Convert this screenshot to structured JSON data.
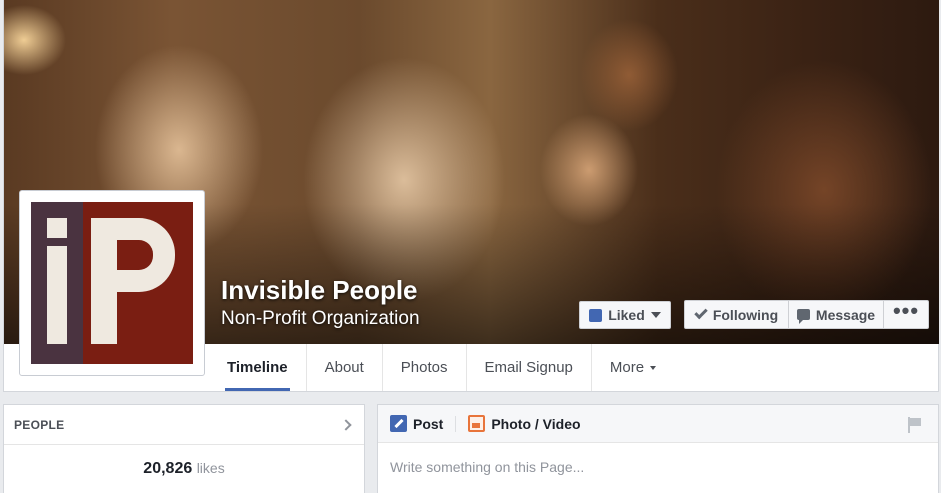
{
  "page": {
    "name": "Invisible People",
    "category": "Non-Profit Organization"
  },
  "actions": {
    "liked_label": "Liked",
    "following_label": "Following",
    "message_label": "Message",
    "more_label": "•••"
  },
  "tabs": [
    {
      "label": "Timeline",
      "active": true
    },
    {
      "label": "About"
    },
    {
      "label": "Photos"
    },
    {
      "label": "Email Signup"
    },
    {
      "label": "More"
    }
  ],
  "people_card": {
    "title": "PEOPLE",
    "likes_count": "20,826",
    "likes_label": "likes"
  },
  "composer": {
    "post_label": "Post",
    "photo_label": "Photo / Video",
    "placeholder": "Write something on this Page..."
  },
  "colors": {
    "accent": "#4267b2",
    "logo_left": "#4a3340",
    "logo_right": "#7a1e12"
  }
}
